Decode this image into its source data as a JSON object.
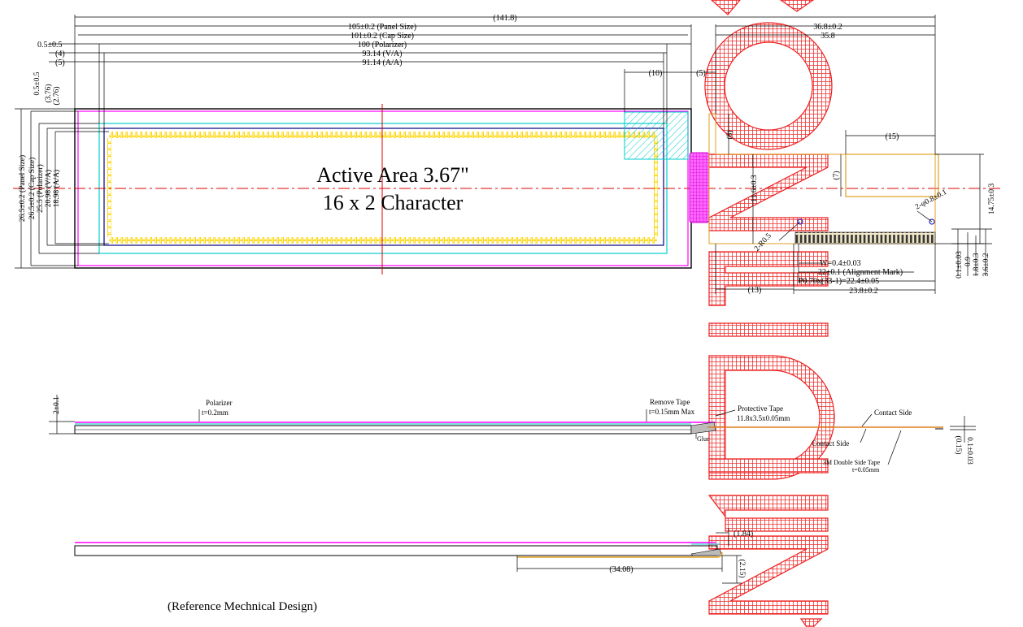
{
  "title": {
    "active_area": "Active Area 3.67\"",
    "characters": "16 x 2 Character",
    "footer": "(Reference Mechnical Design)"
  },
  "watermark": "CONFIDENTIAL",
  "top_dims": {
    "overall": "(141.8)",
    "panel": "105±0.2 (Panel Size)",
    "cap": "101±0.2 (Cap Size)",
    "polarizer": "100 (Polarizer)",
    "va": "93.14 (V/A)",
    "aa": "91.14 (A/A)",
    "left1": "0.5±0.5",
    "left2": "(4)",
    "left3": "(5)",
    "fpc_width": "36.8±0.2",
    "fpc_inner": "35.8",
    "d10": "(10)",
    "d5": "(5)",
    "d8": "(8)",
    "d15": "(15)",
    "d7": "(7)",
    "d11_6": "11.6±0.3"
  },
  "left_dims": {
    "l1": "0.5±0.5",
    "l2": "(3.76)",
    "l3": "(2.76)",
    "aa_h": "18.98 (A/A)",
    "va_h": "20.98 (V/A)",
    "pol_h": "25.5 (Polarizer)",
    "cap_h": "26.5±0.2 (Cap Size)",
    "panel_h": "26.5±0.2 (Panel Size)"
  },
  "fpc_dims": {
    "hole_right": "2-φ0.8±0.1",
    "hole_left": "2-R0.5",
    "height": "14.75±0.3",
    "w": "W=0.4±0.03",
    "align": "22±0.1 (Alignment Mark)",
    "pitch": "P0.70x(33-1)=22.4±0.05",
    "total": "23.8±0.2",
    "d13": "(13)",
    "r1": "3.6±0.2",
    "r2": "1.8±0.3",
    "r3": "0.9",
    "r4": "0.1±0.03"
  },
  "side_view": {
    "thickness": "2±0.1",
    "polarizer": "Polarizer",
    "polarizer_t": "t=0.2mm",
    "remove_tape": "Remove Tape",
    "remove_tape_t": "t=0.15mm Max",
    "protective_tape": "Protective Tape",
    "protective_size": "11.8x3.5x0.05mm",
    "glue": "Glue",
    "contact_side_1": "Contact Side",
    "contact_side_2": "Contact Side",
    "double_tape": "3M Double Side Tape",
    "double_tape_t": "t=0.05mm",
    "fpc_t": "0.1±0.03",
    "fpc_t2": "(0.15)"
  },
  "bottom_view": {
    "d184": "(1.84)",
    "d3408": "(34.08)",
    "d215": "(2.15)"
  },
  "colors": {
    "panel": "#000000",
    "cap": "#ff00ff",
    "polarizer": "#00cccc",
    "va": "#000080",
    "aa": "#ffd400",
    "center": "#dd0000",
    "fpc": "#e0a020",
    "watermark": "#ee2020"
  }
}
